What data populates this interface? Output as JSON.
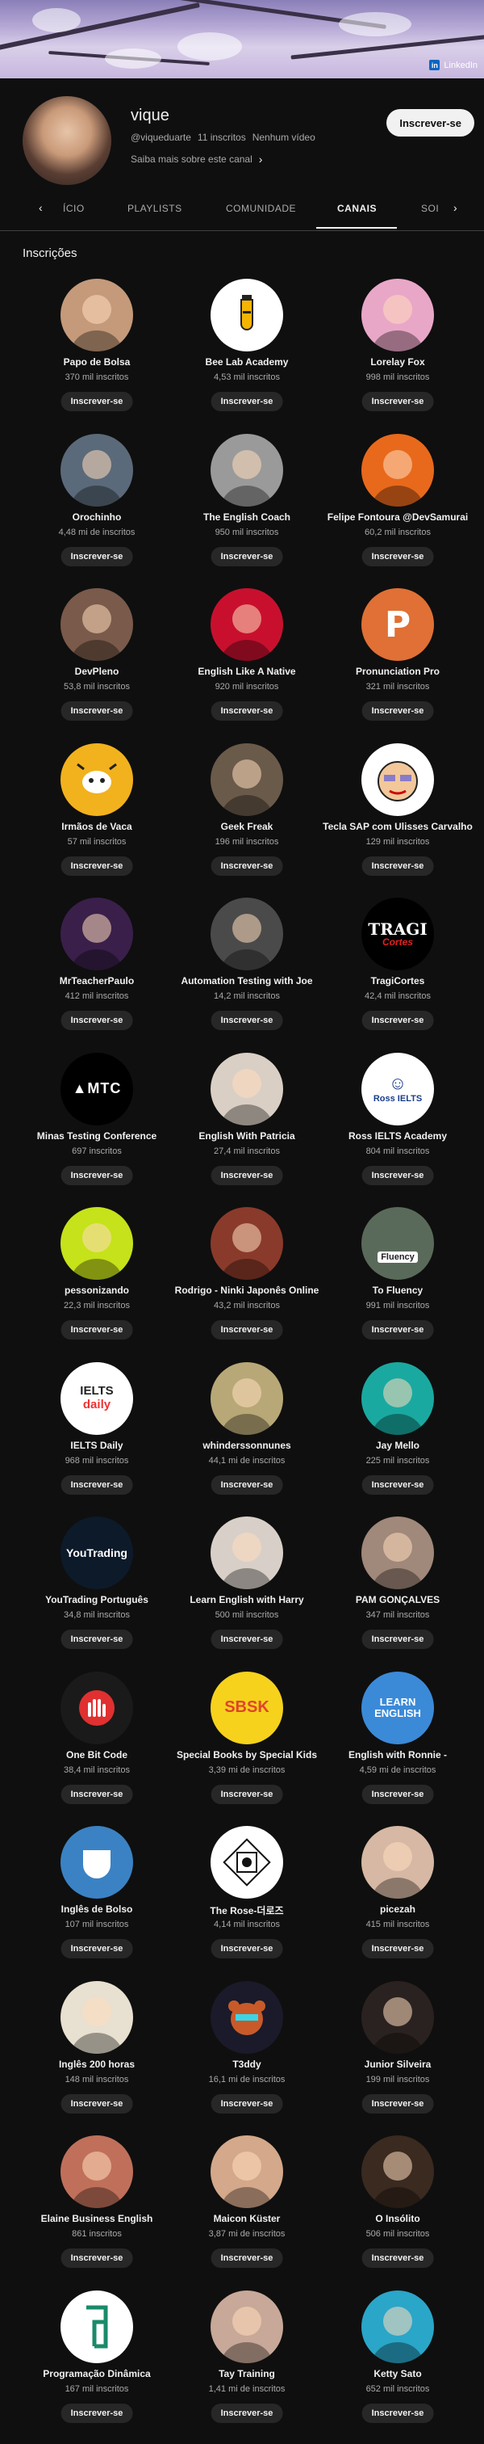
{
  "banner": {
    "link_label": "LinkedIn"
  },
  "channel": {
    "name": "vique",
    "handle": "@viqueduarte",
    "subscribers": "11 inscritos",
    "videos": "Nenhum vídeo",
    "more_label": "Saiba mais sobre este canal",
    "subscribe_label": "Inscrever-se"
  },
  "tabs": [
    {
      "label": "ÍCIO"
    },
    {
      "label": "PLAYLISTS"
    },
    {
      "label": "COMUNIDADE"
    },
    {
      "label": "CANAIS"
    },
    {
      "label": "SOI"
    }
  ],
  "section": {
    "title": "Inscrições"
  },
  "button_label": "Inscrever-se",
  "channels": [
    {
      "name": "Papo de Bolsa",
      "subs": "370 mil inscritos",
      "color": "#c49a7a",
      "icon": ""
    },
    {
      "name": "Bee Lab Academy",
      "subs": "4,53 mil inscritos",
      "color": "#ffffff",
      "icon": "beaker"
    },
    {
      "name": "Lorelay Fox",
      "subs": "998 mil inscritos",
      "color": "#e9a7c7",
      "icon": ""
    },
    {
      "name": "Orochinho",
      "subs": "4,48 mi de inscritos",
      "color": "#5b6a7a",
      "icon": ""
    },
    {
      "name": "The English Coach",
      "subs": "950 mil inscritos",
      "color": "#9a9a9a",
      "icon": ""
    },
    {
      "name": "Felipe Fontoura @DevSamurai",
      "subs": "60,2 mil inscritos",
      "color": "#e8691c",
      "icon": ""
    },
    {
      "name": "DevPleno",
      "subs": "53,8 mil inscritos",
      "color": "#7a5a4a",
      "icon": ""
    },
    {
      "name": "English Like A Native",
      "subs": "920 mil inscritos",
      "color": "#c8102e",
      "icon": ""
    },
    {
      "name": "Pronunciation Pro",
      "subs": "321 mil inscritos",
      "color": "#e07035",
      "icon": "P"
    },
    {
      "name": "Irmãos de Vaca",
      "subs": "57 mil inscritos",
      "color": "#f2b21d",
      "icon": "cow"
    },
    {
      "name": "Geek Freak",
      "subs": "196 mil inscritos",
      "color": "#6a5a4a",
      "icon": ""
    },
    {
      "name": "Tecla SAP com Ulisses Carvalho",
      "subs": "129 mil inscritos",
      "color": "#ffffff",
      "icon": "face"
    },
    {
      "name": "MrTeacherPaulo",
      "subs": "412 mil inscritos",
      "color": "#3a1f4a",
      "icon": ""
    },
    {
      "name": "Automation Testing with Joe",
      "subs": "14,2 mil inscritos",
      "color": "#4a4a4a",
      "icon": ""
    },
    {
      "name": "TragiCortes",
      "subs": "42,4 mil inscritos",
      "color": "#000000",
      "icon": "TRAGI"
    },
    {
      "name": "Minas Testing Conference",
      "subs": "697 inscritos",
      "color": "#000000",
      "icon": "MTC"
    },
    {
      "name": "English With Patricia",
      "subs": "27,4 mil inscritos",
      "color": "#d9cfc4",
      "icon": ""
    },
    {
      "name": "Ross IELTS Academy",
      "subs": "804 mil inscritos",
      "color": "#ffffff",
      "icon": "Ross IELTS"
    },
    {
      "name": "pessonizando",
      "subs": "22,3 mil inscritos",
      "color": "#c6e21a",
      "icon": ""
    },
    {
      "name": "Rodrigo - Ninki Japonês Online",
      "subs": "43,2 mil inscritos",
      "color": "#8a3a2a",
      "icon": ""
    },
    {
      "name": "To Fluency",
      "subs": "991 mil inscritos",
      "color": "#5a6a5a",
      "icon": "Fluency"
    },
    {
      "name": "IELTS Daily",
      "subs": "968 mil inscritos",
      "color": "#ffffff",
      "icon": "IELTS daily"
    },
    {
      "name": "whinderssonnunes",
      "subs": "44,1 mi de inscritos",
      "color": "#b8a877",
      "icon": ""
    },
    {
      "name": "Jay Mello",
      "subs": "225 mil inscritos",
      "color": "#1aa9a0",
      "icon": ""
    },
    {
      "name": "YouTrading Português",
      "subs": "34,8 mil inscritos",
      "color": "#0d1a2a",
      "icon": "YouTrading"
    },
    {
      "name": "Learn English with Harry",
      "subs": "500 mil inscritos",
      "color": "#d8d0c8",
      "icon": ""
    },
    {
      "name": "PAM GONÇALVES",
      "subs": "347 mil inscritos",
      "color": "#a0887a",
      "icon": ""
    },
    {
      "name": "One Bit Code",
      "subs": "38,4 mil inscritos",
      "color": "#1a1a1a",
      "icon": "hand"
    },
    {
      "name": "Special Books by Special Kids",
      "subs": "3,39 mi de inscritos",
      "color": "#f6d21c",
      "icon": "SBSK"
    },
    {
      "name": "English with Ronnie -",
      "subs": "4,59 mi de inscritos",
      "color": "#3b8ad8",
      "icon": "LEARN ENGLISH"
    },
    {
      "name": "Inglês de Bolso",
      "subs": "107 mil inscritos",
      "color": "#3b82c4",
      "icon": "pocket"
    },
    {
      "name": "The Rose-더로즈",
      "subs": "4,14 mil inscritos",
      "color": "#ffffff",
      "icon": "pattern"
    },
    {
      "name": "picezah",
      "subs": "415 mil inscritos",
      "color": "#d6b8a4",
      "icon": ""
    },
    {
      "name": "Inglês 200 horas",
      "subs": "148 mil inscritos",
      "color": "#e8e0d0",
      "icon": ""
    },
    {
      "name": "T3ddy",
      "subs": "16,1 mi de inscritos",
      "color": "#1a1a2a",
      "icon": "bear"
    },
    {
      "name": "Junior Silveira",
      "subs": "199 mil inscritos",
      "color": "#2a2220",
      "icon": ""
    },
    {
      "name": "Elaine Business English",
      "subs": "861 inscritos",
      "color": "#c0705a",
      "icon": ""
    },
    {
      "name": "Maicon Küster",
      "subs": "3,87 mi de inscritos",
      "color": "#d4a88a",
      "icon": ""
    },
    {
      "name": "O Insólito",
      "subs": "506 mil inscritos",
      "color": "#3a2a20",
      "icon": ""
    },
    {
      "name": "Programação Dinâmica",
      "subs": "167 mil inscritos",
      "color": "#ffffff",
      "icon": "PD"
    },
    {
      "name": "Tay Training",
      "subs": "1,41 mi de inscritos",
      "color": "#c8a898",
      "icon": ""
    },
    {
      "name": "Ketty Sato",
      "subs": "652 mil inscritos",
      "color": "#2aa6c8",
      "icon": ""
    }
  ]
}
